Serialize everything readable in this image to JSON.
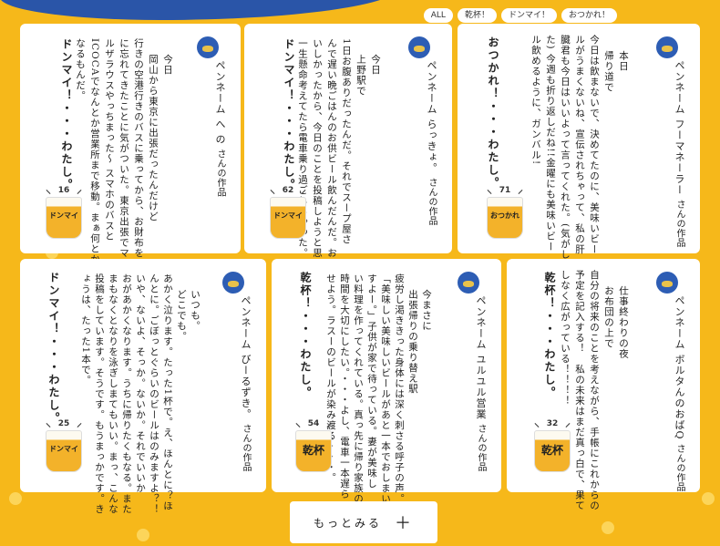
{
  "filters": [
    "ALL",
    "乾杯！",
    "ドンマイ！",
    "おつかれ！"
  ],
  "penname_label": "ペンネーム",
  "penname_suffix": "さんの作品",
  "posts": [
    {
      "penname": "フーマネーラー",
      "time": "本日",
      "body": "帰り道で\n今日は飲まないで、決めてたのに、美味いビー\nルがうまくないね、宣伝されちゃって、私の肝\n臓君も今日はいいよって言ってくれた。(気がし\nた) 今週も折り返しだね!!金曜にも美味いビー\nル飲めるように、ガンバル!",
      "sign": "おつかれ！・・・わたし。",
      "count": "71",
      "glass": "おつかれ"
    },
    {
      "penname": "らっきょ。",
      "time": "今日",
      "body": "上野駅で\n1日お腹ありだったんだ。それでスープ屋さ\nんで遅い晩ごはんのお供ビール飲んだんだ。お\nいしかったから、今日のことを投稿しようと思って\n一生懸命考えてたら電車乗り過ごしちゃった。",
      "sign": "ドンマイ！・・・わたし。",
      "count": "62",
      "glass": "ドンマイ"
    },
    {
      "penname": "へ の",
      "time": "今日",
      "body": "岡山から東京に出張だったんだけど\n行きの空港行きのバスに乗ってから、お財布をお家\nに忘れてきたことに気がついた。東京出張でマリア\nルザラウスやっちまった〜 スマホのバスと\nICOCAでなんとか営業所まで移動。まぁ何とか\nなるもんだ。",
      "sign": "ドンマイ！・・・わたし。",
      "count": "16",
      "glass": "ドンマイ"
    },
    {
      "penname": "ボルタんのおばQ",
      "time": "仕事終わりの夜",
      "body": "お布団の上で\n自分の将来のことを考えながら、手帳にこれからの\n予定を記入する！　私の未来はまだ真っ白で、果て\nしなく広がっている！！！！",
      "sign": "乾杯！・・・わたし。",
      "count": "32",
      "glass": "乾杯"
    },
    {
      "penname": "ユルユル営業",
      "time": "今まさに",
      "body": "出張帰りの乗り替え駅\n疲労し渇ききった身体には深く刺さる呼子の声。\n「美味しい美味しいビールがあと一本でおしまいで\nすよー。」子供が家で待っている。妻が美味し\nい料理を作ってくれている。真っ先に帰り家族の\n時間を大切にしたい。・・・よし、電車一本遅ら\nせよう。ラスーのビールが染み渡る・・・。",
      "sign": "乾杯！・・・わたし。",
      "count": "54",
      "glass": "乾杯"
    },
    {
      "penname": "びーるずき。",
      "time": "いつも。",
      "body": "どこでも。\nあかく泣ります。たった1杯で。え、ほんとに？ほ\nんとに。ごぼっとぐらいのビールはのみますよ？！\nいや、ないよ、そっか。ないか。それでいいか\nおがあかくなります。うちに帰りたくもなる。また\nまもなくとなりを泳ぎしまてもいい。まっ、こんな\n投稿をしています。そうです。もうまっかです。き\nょうは、たった1本で。",
      "sign": "ドンマイ！・・・わたし。",
      "count": "25",
      "glass": "ドンマイ"
    }
  ],
  "more_label": "もっとみる",
  "colors": {
    "background": "#f6b81a",
    "card": "#ffffff",
    "beer": "#f3b22a"
  }
}
